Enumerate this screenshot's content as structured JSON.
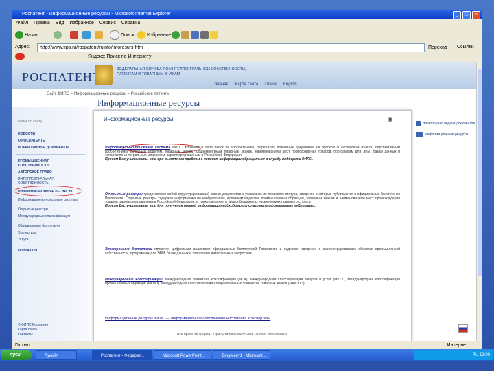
{
  "window": {
    "title": "Роспатент - Информационные ресурсы - Microsoft Internet Explorer",
    "minimize": "_",
    "maximize": "□",
    "close": "×"
  },
  "menu": [
    "Файл",
    "Правка",
    "Вид",
    "Избранное",
    "Сервис",
    "Справка"
  ],
  "toolbar": {
    "back": "Назад",
    "search": "Поиск",
    "favorites": "Избранное"
  },
  "address": {
    "label": "Адрес:",
    "url": "http://www.fips.ru/rospatent/ruinfo/inforesurs.htm",
    "go": "Переход",
    "links": "Ссылки"
  },
  "linkbar": {
    "text": "Яндекс: Поиск по Интернету"
  },
  "site": {
    "logo": "РОСПАТЕНТ",
    "agency": "ФЕДЕРАЛЬНАЯ СЛУЖБА ПО ИНТЕЛЛЕКТУАЛЬНОЙ СОБСТВЕННОСТИ, ПАТЕНТАМ И ТОВАРНЫМ ЗНАКАМ",
    "topnav": [
      "Главная",
      "Карта сайта",
      "Поиск",
      "English"
    ],
    "breadcrumb": "Сайт ФИПС > Информационные ресурсы > Российские патенты",
    "page_title": "Информационные ресурсы"
  },
  "sidebar": {
    "search_label": "Поиск по сайту",
    "items": [
      "НОВОСТИ",
      "О РОСПАТЕНТЕ",
      "НОРМАТИВНЫЕ ДОКУМЕНТЫ",
      "ПРОМЫШЛЕННАЯ СОБСТВЕННОСТЬ",
      "АВТОРСКОЕ ПРАВО",
      "ИНТЕЛЛЕКТУАЛЬНАЯ СОБСТВЕННОСТЬ",
      "ИНФОРМАЦИОННЫЕ РЕСУРСЫ",
      "Информационно-поисковые системы",
      "Открытые реестры",
      "Международные классификации",
      "Официальные бюллетени",
      "Экспертиза",
      "Услуги",
      "КОНТАКТЫ"
    ]
  },
  "card": {
    "title": "Информационные ресурсы",
    "p1_link": "Информационно-поисковая система",
    "p1": " ФИПС включает в себя поиск по изобретениям, рефератам патентных документов на русском и английском языках, перспективным изобретениям, полезным моделям, товарным знакам, общеизвестным товарным знакам, наименованиям мест происхождения товаров, программам для ЭВМ, базам данных и топологиям интегральных микросхем, зарегистрированным в Российской Федерации.",
    "p1_note": "Просим Вас учитывать, что при выявлении проблем с поиском информации обращаться в службу поддержки ФИПС.",
    "p2_link": "Открытые реестры",
    "p2": " представляют собой структурированный список документов с указанием их правового статуса, сведения о которых публикуются в официальных бюллетенях Роспатента. Открытые реестры содержат информацию по изобретениям, полезным моделям, промышленным образцам, товарным знакам и наименованиям мест происхождения товаров, зарегистрированным в Российской Федерации, а также сведения о правообладателях и изменениях правового статуса.",
    "p2_note": "Просим Вас учитывать, что для получения полной информации необходимо использовать официальные публикации.",
    "p3_link": "Электронные бюллетени",
    "p3": " являются цифровыми аналогами официальных бюллетеней Роспатента и содержат сведения о зарегистрированных объектах промышленной собственности, программах для ЭВМ, базах данных и топологиях интегральных микросхем.",
    "p4_link": "Международные классификации",
    "p4": ": Международная патентная классификация (МПК), Международная классификация товаров и услуг (МКТУ), Международная классификация промышленных образцов (МКПО), Международная классификация изобразительных элементов товарных знаков (МКИЭТЗ).",
    "bottom_link": "Информационные ресурсы ФИПС — информационное обеспечение Роспатента и экспертизы"
  },
  "right_links": [
    "Электронная подача документов",
    "Информационные ресурсы"
  ],
  "footer": {
    "left": [
      "© ФИПС Роспатент",
      "Карта сайта",
      "Контакты"
    ],
    "center": "Все права защищены. При цитировании ссылка на сайт обязательна."
  },
  "status": {
    "left": "Готово",
    "zone": "Интернет"
  },
  "taskbar": {
    "start": "пуск",
    "tasks": [
      "Лукойл",
      "Роспатент - Федерал...",
      "Microsoft PowerPoint...",
      "Документ1 - Microsoft..."
    ],
    "clock": "RU 12:00"
  },
  "colors": {
    "brand": "#1f3f7a",
    "highlight_circle": "#d02020",
    "link": "#1a1a8a"
  }
}
